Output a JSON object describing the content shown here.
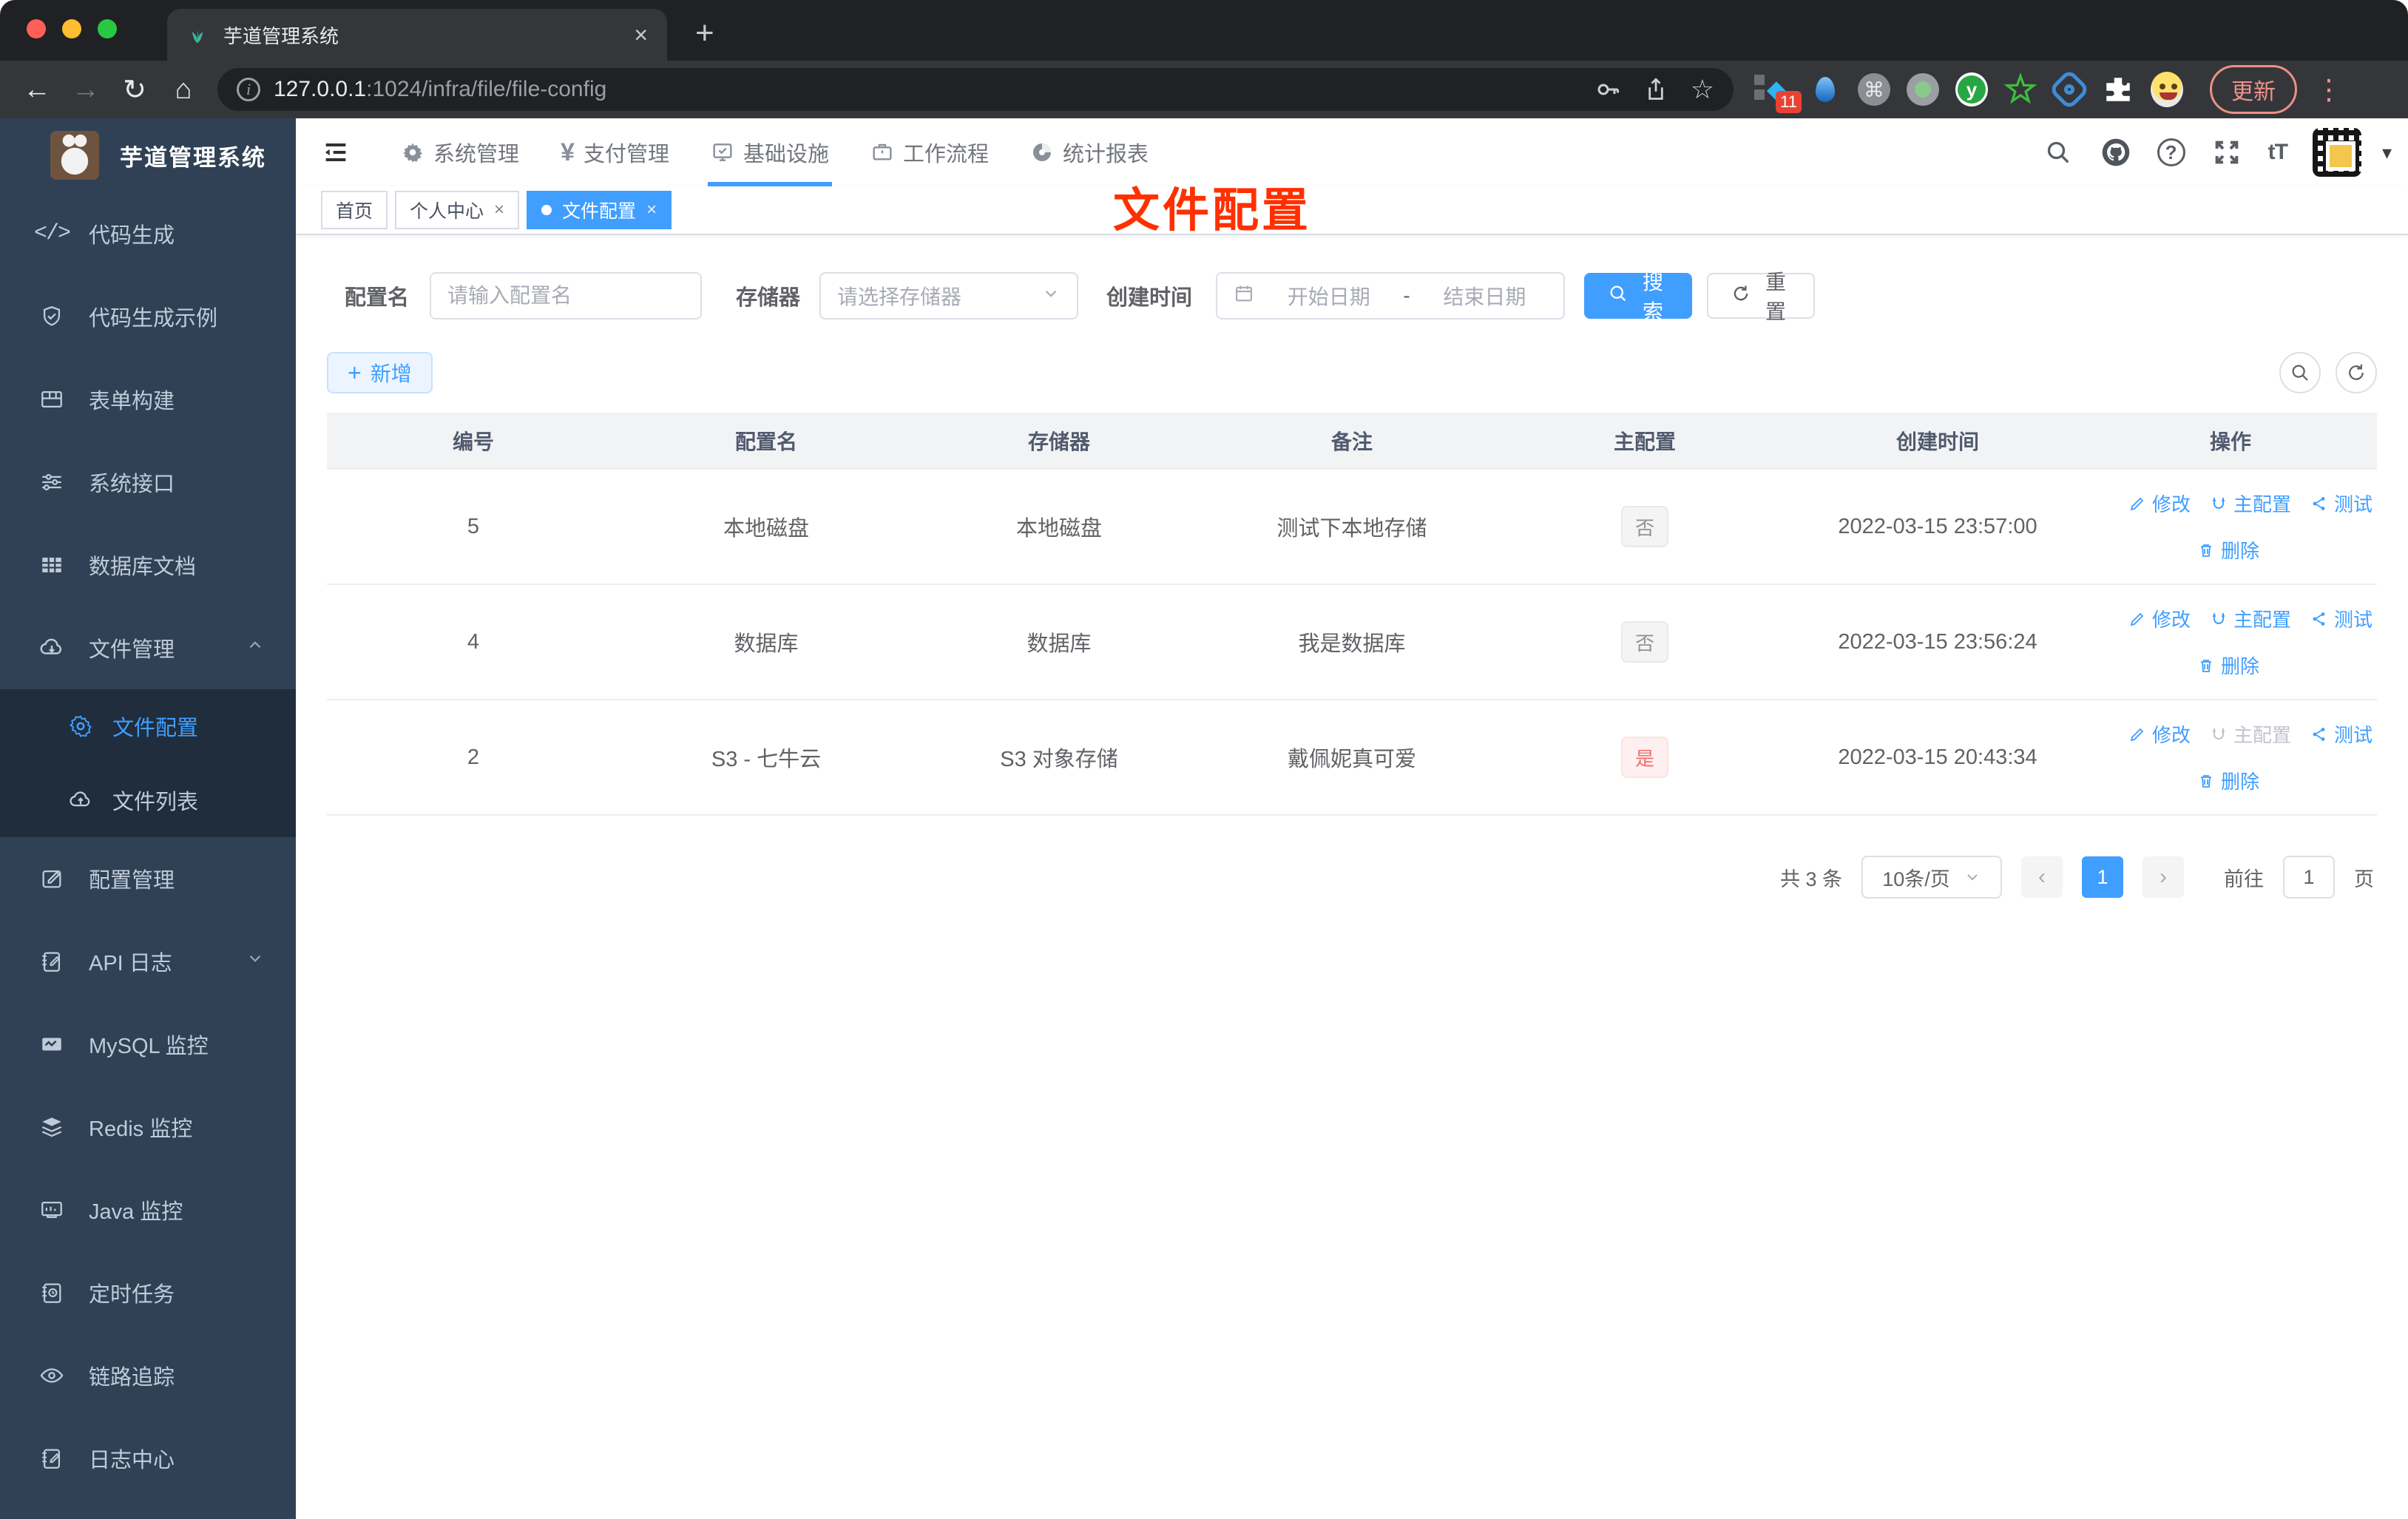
{
  "colors": {
    "accent": "#409eff",
    "danger": "#f56c6c",
    "sidebar_bg": "#304156",
    "submenu_bg": "#1f2d3d",
    "annotation_red": "#ff3000"
  },
  "browser": {
    "tab_title": "芋道管理系统",
    "close_glyph": "×",
    "new_tab_glyph": "+",
    "back_glyph": "←",
    "forward_glyph": "→",
    "reload_glyph": "↻",
    "home_glyph": "⌂",
    "url_host": "127.0.0.1",
    "url_rest": ":1024/infra/file/file-config",
    "star_glyph": "☆",
    "cmd_glyph": "⌘",
    "ext_badge": "11",
    "ext_y_letter": "y",
    "update_label": "更新",
    "dots_glyph": "⋮"
  },
  "sidebar": {
    "title": "芋道管理系统",
    "code_glyph": "</>",
    "items": [
      "代码生成",
      "代码生成示例",
      "表单构建",
      "系统接口",
      "数据库文档",
      "文件管理",
      "文件配置",
      "文件列表",
      "配置管理",
      "API 日志",
      "MySQL 监控",
      "Redis 监控",
      "Java 监控",
      "定时任务",
      "链路追踪",
      "日志中心"
    ]
  },
  "header": {
    "nav": [
      "系统管理",
      "支付管理",
      "基础设施",
      "工作流程",
      "统计报表"
    ],
    "yen_glyph": "¥",
    "question_glyph": "?",
    "font_size_glyph": "tT",
    "caret_glyph": "▾"
  },
  "tags": {
    "home": "首页",
    "profile": "个人中心",
    "current": "文件配置",
    "close_glyph": "×"
  },
  "annotation": "文件配置",
  "filters": {
    "name_label": "配置名",
    "name_placeholder": "请输入配置名",
    "storage_label": "存储器",
    "storage_placeholder": "请选择存储器",
    "date_label": "创建时间",
    "date_start": "开始日期",
    "date_sep": "-",
    "date_end": "结束日期",
    "search_label": "搜索",
    "reset_label": "重置"
  },
  "toolbar": {
    "add_label": "新增",
    "plus_glyph": "+"
  },
  "table": {
    "headers": [
      "编号",
      "配置名",
      "存储器",
      "备注",
      "主配置",
      "创建时间",
      "操作"
    ],
    "actions": {
      "edit": "修改",
      "master": "主配置",
      "test": "测试",
      "delete": "删除"
    },
    "rows": [
      {
        "id": "5",
        "name": "本地磁盘",
        "storage": "本地磁盘",
        "remark": "测试下本地存储",
        "master": "否",
        "created": "2022-03-15 23:57:00"
      },
      {
        "id": "4",
        "name": "数据库",
        "storage": "数据库",
        "remark": "我是数据库",
        "master": "否",
        "created": "2022-03-15 23:56:24"
      },
      {
        "id": "2",
        "name": "S3 - 七牛云",
        "storage": "S3 对象存储",
        "remark": "戴佩妮真可爱",
        "master": "是",
        "created": "2022-03-15 20:43:34"
      }
    ]
  },
  "pagination": {
    "total": "共 3 条",
    "size": "10条/页",
    "prev_glyph": "‹",
    "page": "1",
    "next_glyph": "›",
    "goto_label": "前往",
    "goto_value": "1",
    "suffix": "页"
  }
}
